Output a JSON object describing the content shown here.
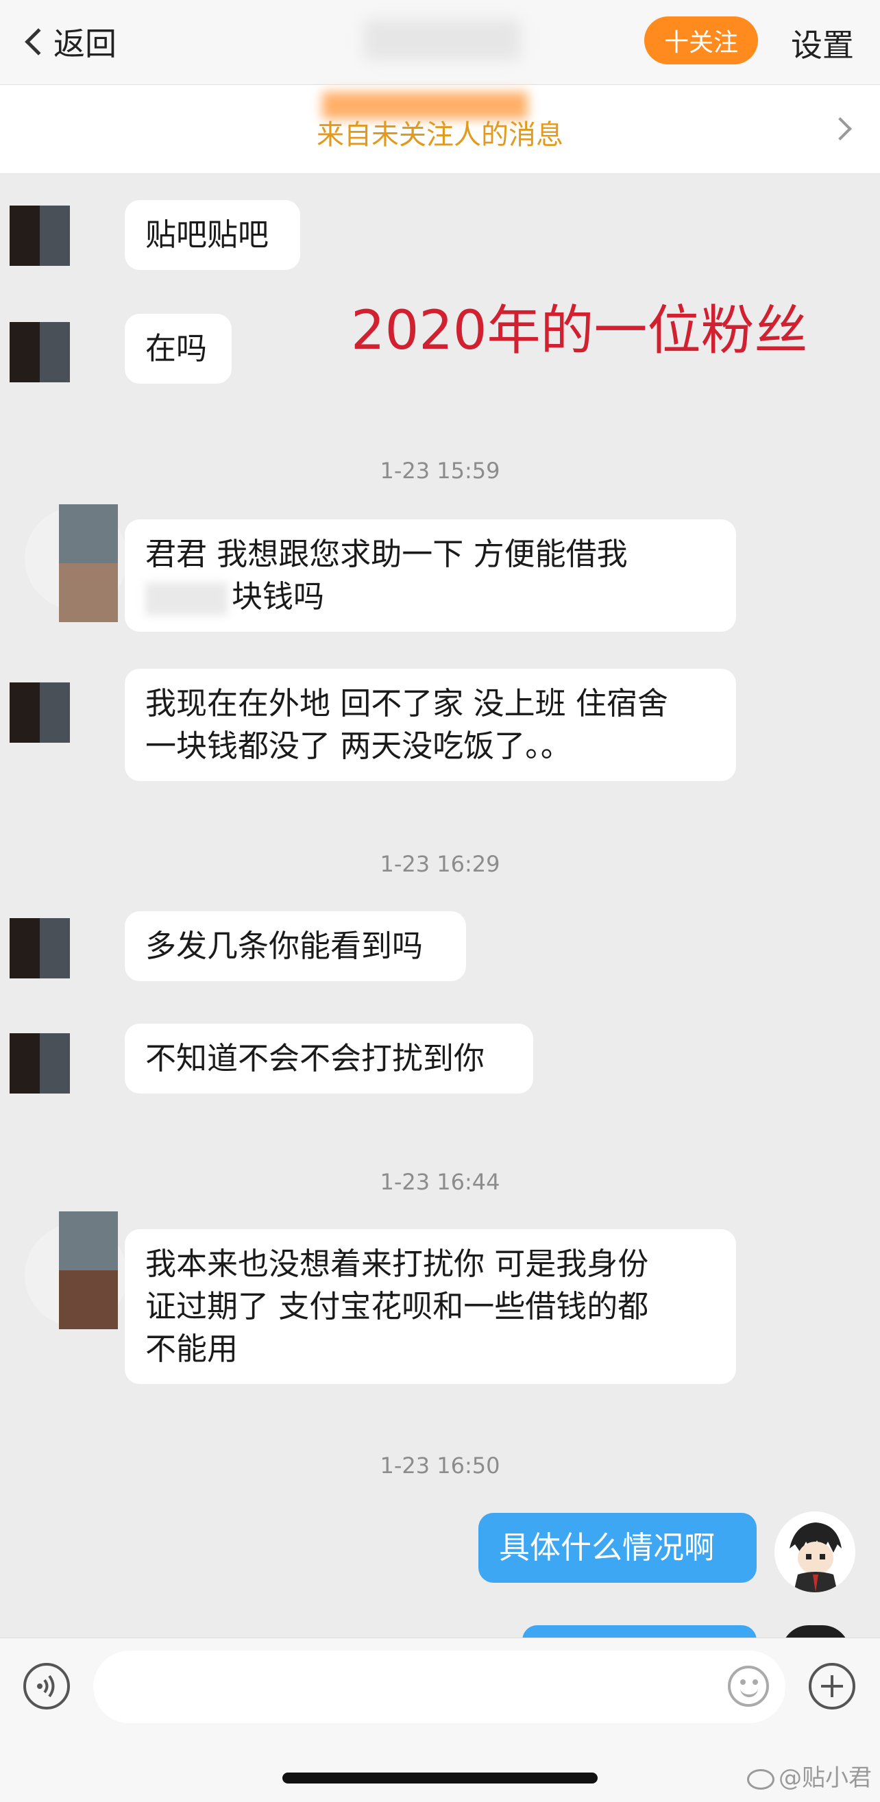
{
  "nav": {
    "back_label": "返回",
    "follow_label": "十关注",
    "settings_label": "设置"
  },
  "notice": {
    "text": "来自未关注人的消息"
  },
  "overlay": {
    "caption": "2020年的一位粉丝"
  },
  "messages": [
    {
      "type": "in",
      "text": "贴吧贴吧"
    },
    {
      "type": "in",
      "text": "在吗"
    },
    {
      "type": "time",
      "text": "1-23 15:59"
    },
    {
      "type": "in",
      "line1": "君君 我想跟您求助一下 方便能借我",
      "line2": "块钱吗"
    },
    {
      "type": "in",
      "line1": "我现在在外地 回不了家 没上班 住宿舍",
      "line2": "一块钱都没了 两天没吃饭了。。"
    },
    {
      "type": "time",
      "text": "1-23 16:29"
    },
    {
      "type": "in",
      "text": "多发几条你能看到吗"
    },
    {
      "type": "in",
      "text": "不知道不会不会打扰到你"
    },
    {
      "type": "time",
      "text": "1-23 16:44"
    },
    {
      "type": "in",
      "line1": "我本来也没想着来打扰你  可是我身份",
      "line2": "证过期了 支付宝花呗和一些借钱的都",
      "line3": "不能用"
    },
    {
      "type": "time",
      "text": "1-23 16:50"
    },
    {
      "type": "out",
      "text": "具体什么情况啊"
    }
  ],
  "composer": {
    "placeholder": ""
  },
  "watermark": {
    "text": "@贴小君"
  },
  "icons": [
    "chevron-left-icon",
    "chevron-right-icon",
    "voice-icon",
    "emoji-icon",
    "plus-icon",
    "weibo-icon"
  ],
  "colors": {
    "follow_button": "#ff8a1e",
    "notice_text": "#e29a1e",
    "outgoing_bubble": "#3ea7f3",
    "overlay_text": "#d1202f",
    "background": "#ececec"
  }
}
